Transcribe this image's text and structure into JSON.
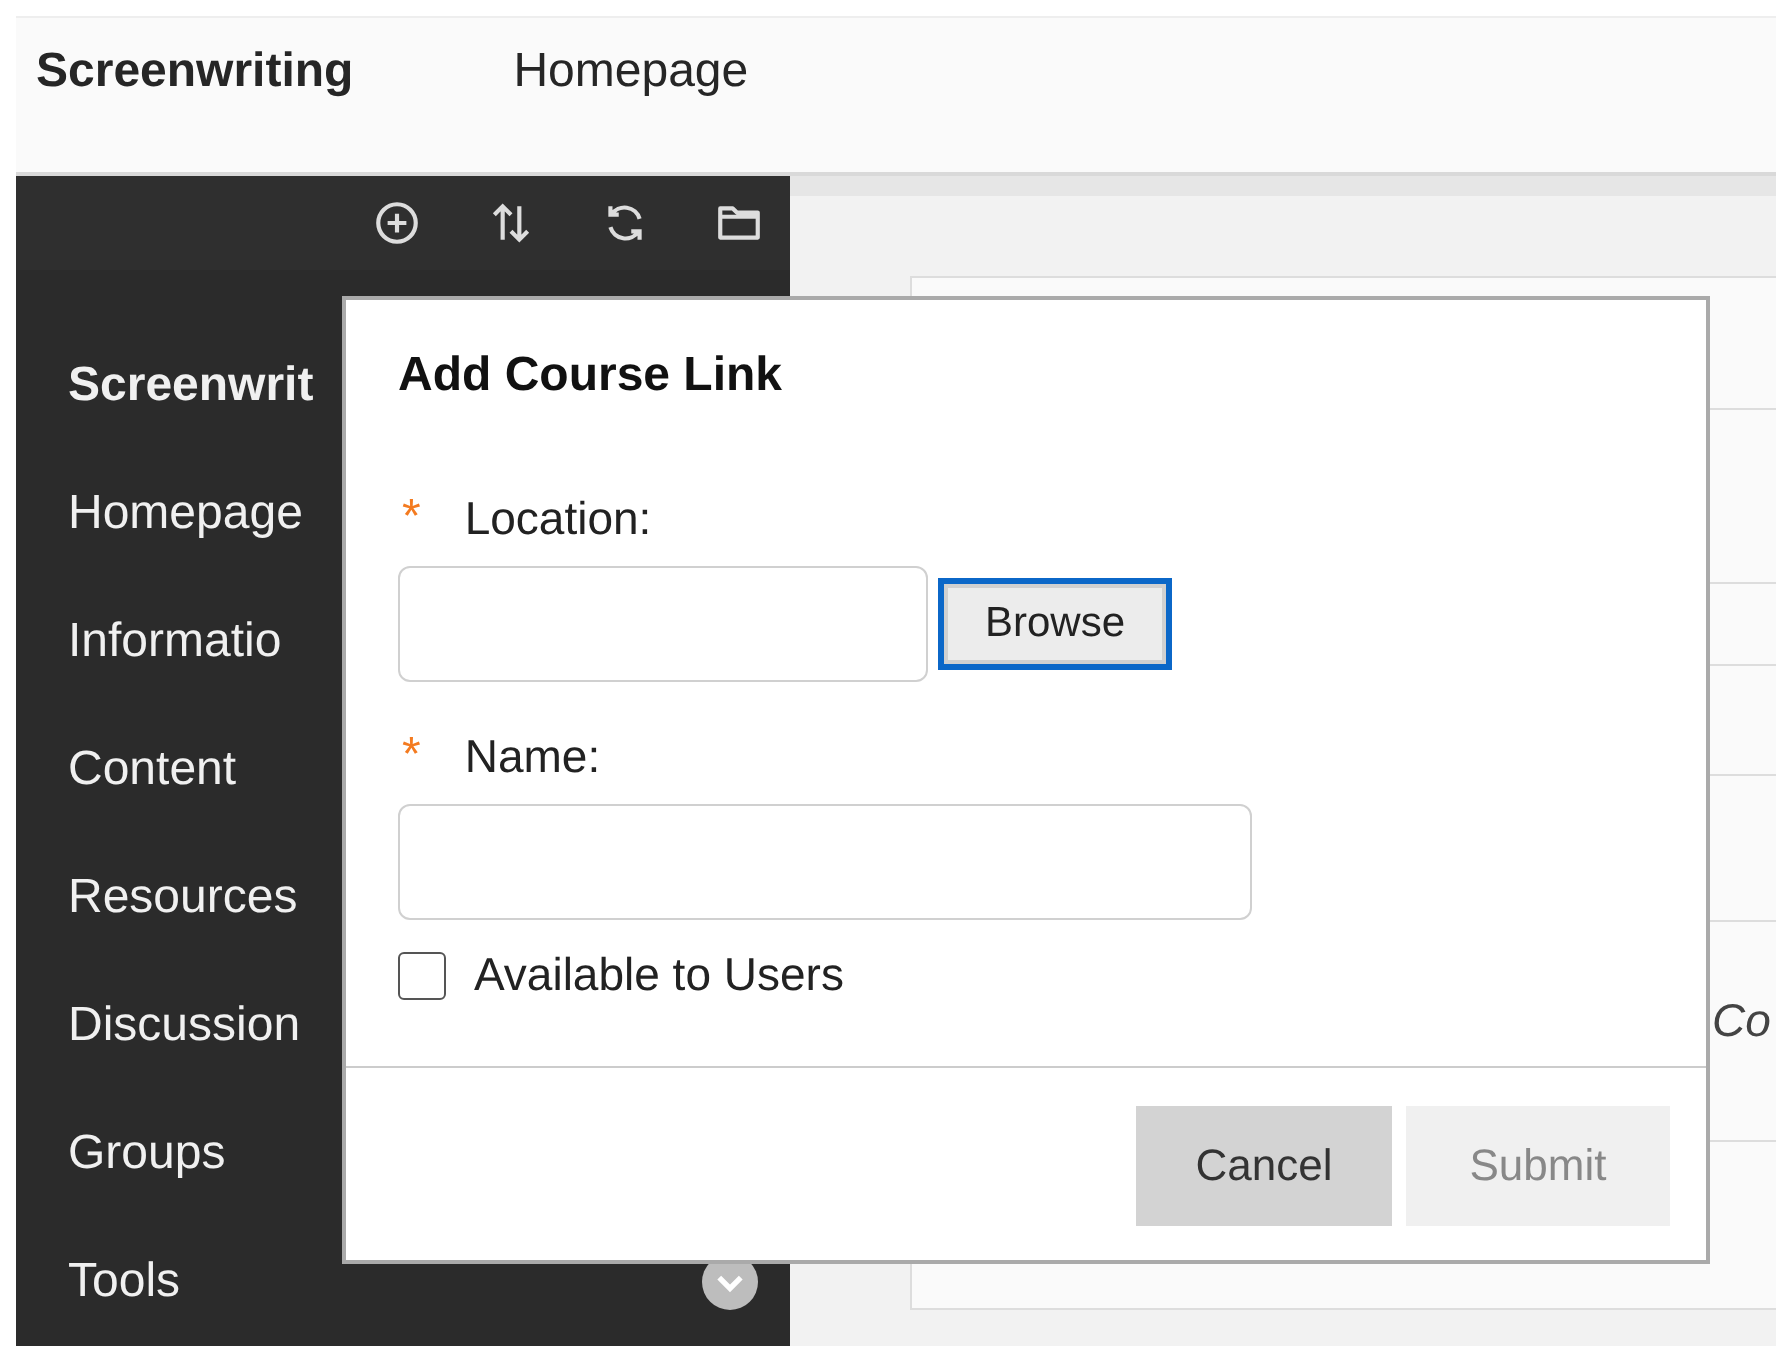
{
  "header": {
    "course": "Screenwriting",
    "page": "Homepage"
  },
  "sidebar": {
    "items": [
      {
        "label": "Screenwrit",
        "bold": true
      },
      {
        "label": "Homepage",
        "bold": false
      },
      {
        "label": "Informatio",
        "bold": false
      },
      {
        "label": "Content",
        "bold": false
      },
      {
        "label": "Resources",
        "bold": false
      },
      {
        "label": "Discussion",
        "bold": false
      },
      {
        "label": "Groups",
        "bold": false
      },
      {
        "label": "Tools",
        "bold": false,
        "has_menu": true
      }
    ]
  },
  "content": {
    "row_text": "Co"
  },
  "dialog": {
    "title": "Add Course Link",
    "location": {
      "label": "Location:",
      "required_mark": "*",
      "browse": "Browse"
    },
    "name": {
      "label": "Name:",
      "required_mark": "*"
    },
    "available": {
      "label": "Available to Users",
      "checked": false
    },
    "buttons": [
      {
        "label": "Cancel",
        "disabled": false
      },
      {
        "label": "Submit",
        "disabled": true
      }
    ]
  }
}
